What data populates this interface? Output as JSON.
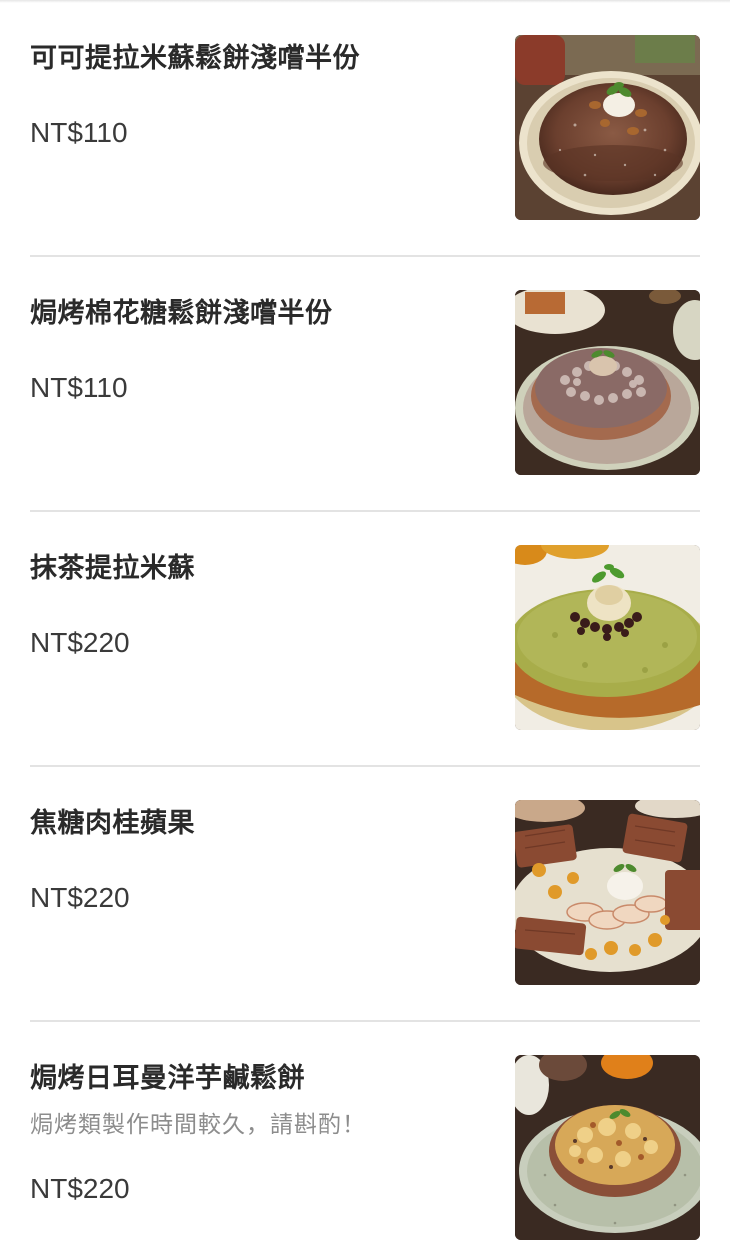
{
  "menu": {
    "items": [
      {
        "name": "可可提拉米蘇鬆餅淺嚐半份",
        "price": "NT$110",
        "image_icon": "cocoa-tiramisu-waffle-photo"
      },
      {
        "name": "焗烤棉花糖鬆餅淺嚐半份",
        "price": "NT$110",
        "image_icon": "baked-marshmallow-waffle-photo"
      },
      {
        "name": "抹茶提拉米蘇",
        "price": "NT$220",
        "image_icon": "matcha-tiramisu-waffle-photo"
      },
      {
        "name": "焦糖肉桂蘋果",
        "price": "NT$220",
        "image_icon": "caramel-cinnamon-apple-waffle-photo"
      },
      {
        "name": "焗烤日耳曼洋芋鹹鬆餅",
        "description": "焗烤類製作時間較久，請斟酌！",
        "price": "NT$220",
        "image_icon": "baked-german-potato-waffle-photo"
      }
    ]
  },
  "colors": {
    "background": "#ffffff",
    "title_text": "#2a2a2a",
    "price_text": "#3a3a3a",
    "description_text": "#8c8c8c",
    "divider": "#e3e3e3"
  }
}
